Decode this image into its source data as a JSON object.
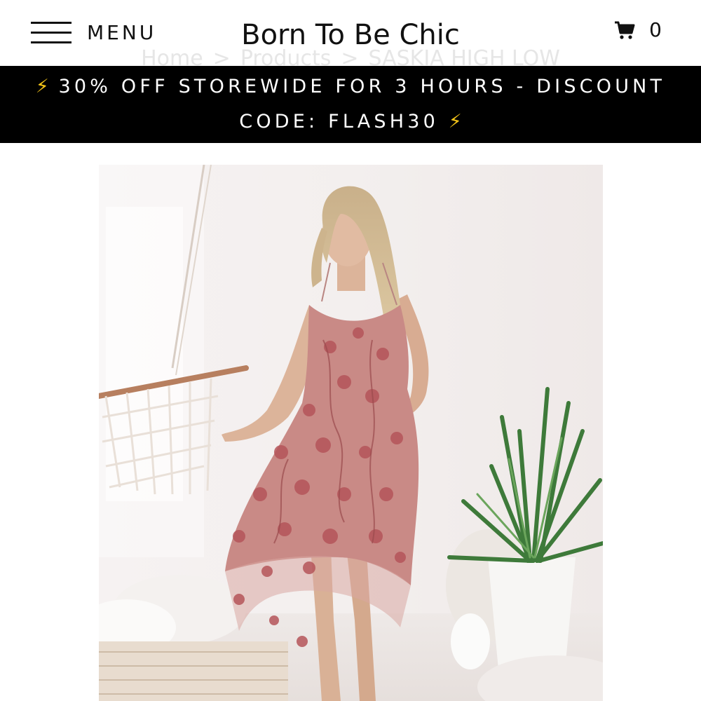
{
  "header": {
    "menu_label": "MENU",
    "site_title": "Born To Be Chic",
    "cart_count": "0",
    "breadcrumb": [
      "Home",
      "Products",
      "SASKIA HIGH LOW"
    ],
    "breadcrumb_separator": ">"
  },
  "banner": {
    "line1": "30% OFF STOREWIDE FOR 3 HOURS - DISCOUNT",
    "line2": "CODE: FLASH30",
    "bolt_icon": "⚡"
  },
  "product": {
    "dress_color": "#c98a86",
    "floral_color": "#b5555a"
  },
  "icons": {
    "menu": "hamburger-icon",
    "cart": "cart-icon",
    "bolt": "lightning-bolt-icon"
  }
}
